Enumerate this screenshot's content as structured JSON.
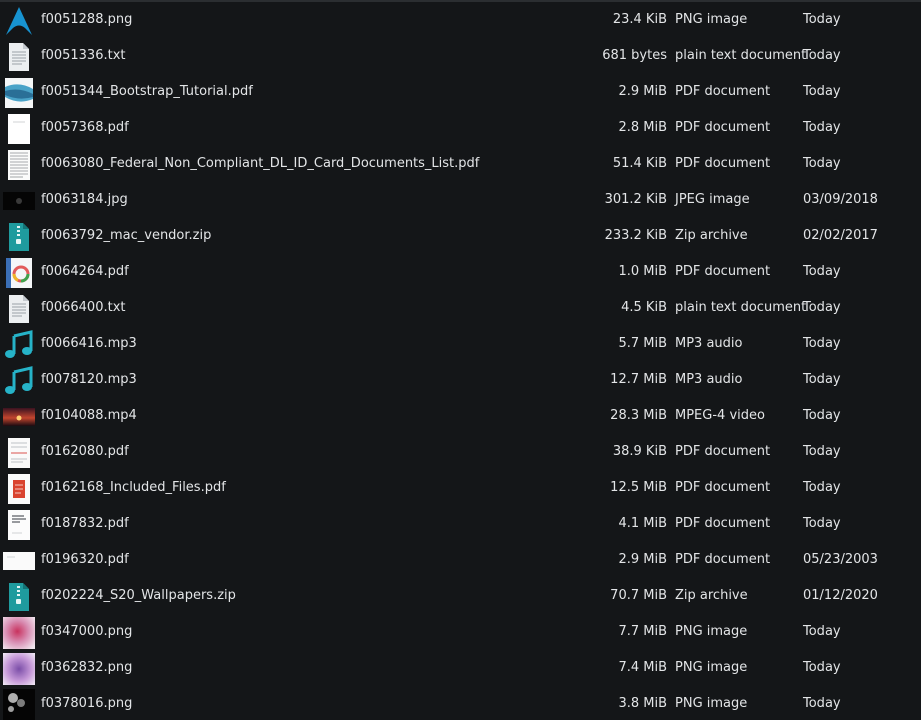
{
  "files": [
    {
      "name": "f0051288.png",
      "size": "23.4 KiB",
      "type": "PNG image",
      "date": "Today",
      "icon": "arch-logo-icon"
    },
    {
      "name": "f0051336.txt",
      "size": "681 bytes",
      "type": "plain text document",
      "date": "Today",
      "icon": "text-document-icon"
    },
    {
      "name": "f0051344_Bootstrap_Tutorial.pdf",
      "size": "2.9 MiB",
      "type": "PDF document",
      "date": "Today",
      "icon": "pdf-thumbnail-icon"
    },
    {
      "name": "f0057368.pdf",
      "size": "2.8 MiB",
      "type": "PDF document",
      "date": "Today",
      "icon": "pdf-thumbnail-icon"
    },
    {
      "name": "f0063080_Federal_Non_Compliant_DL_ID_Card_Documents_List.pdf",
      "size": "51.4 KiB",
      "type": "PDF document",
      "date": "Today",
      "icon": "pdf-thumbnail-icon"
    },
    {
      "name": "f0063184.jpg",
      "size": "301.2 KiB",
      "type": "JPEG image",
      "date": "03/09/2018",
      "icon": "image-thumbnail-icon"
    },
    {
      "name": "f0063792_mac_vendor.zip",
      "size": "233.2 KiB",
      "type": "Zip archive",
      "date": "02/02/2017",
      "icon": "zip-archive-icon"
    },
    {
      "name": "f0064264.pdf",
      "size": "1.0 MiB",
      "type": "PDF document",
      "date": "Today",
      "icon": "pdf-thumbnail-icon"
    },
    {
      "name": "f0066400.txt",
      "size": "4.5 KiB",
      "type": "plain text document",
      "date": "Today",
      "icon": "text-document-icon"
    },
    {
      "name": "f0066416.mp3",
      "size": "5.7 MiB",
      "type": "MP3 audio",
      "date": "Today",
      "icon": "music-note-icon"
    },
    {
      "name": "f0078120.mp3",
      "size": "12.7 MiB",
      "type": "MP3 audio",
      "date": "Today",
      "icon": "music-note-icon"
    },
    {
      "name": "f0104088.mp4",
      "size": "28.3 MiB",
      "type": "MPEG-4 video",
      "date": "Today",
      "icon": "video-thumbnail-icon"
    },
    {
      "name": "f0162080.pdf",
      "size": "38.9 KiB",
      "type": "PDF document",
      "date": "Today",
      "icon": "pdf-thumbnail-icon"
    },
    {
      "name": "f0162168_Included_Files.pdf",
      "size": "12.5 MiB",
      "type": "PDF document",
      "date": "Today",
      "icon": "pdf-thumbnail-icon"
    },
    {
      "name": "f0187832.pdf",
      "size": "4.1 MiB",
      "type": "PDF document",
      "date": "Today",
      "icon": "pdf-thumbnail-icon"
    },
    {
      "name": "f0196320.pdf",
      "size": "2.9 MiB",
      "type": "PDF document",
      "date": "05/23/2003",
      "icon": "pdf-thumbnail-icon"
    },
    {
      "name": "f0202224_S20_Wallpapers.zip",
      "size": "70.7 MiB",
      "type": "Zip archive",
      "date": "01/12/2020",
      "icon": "zip-archive-icon"
    },
    {
      "name": "f0347000.png",
      "size": "7.7 MiB",
      "type": "PNG image",
      "date": "Today",
      "icon": "image-thumbnail-icon"
    },
    {
      "name": "f0362832.png",
      "size": "7.4 MiB",
      "type": "PNG image",
      "date": "Today",
      "icon": "image-thumbnail-icon"
    },
    {
      "name": "f0378016.png",
      "size": "3.8 MiB",
      "type": "PNG image",
      "date": "Today",
      "icon": "image-thumbnail-icon"
    }
  ],
  "colors": {
    "background": "#141618",
    "text": "#e3e5e7",
    "arch_blue": "#1793d1",
    "music_teal": "#26b3c8",
    "zip_teal": "#1f9b9e"
  }
}
